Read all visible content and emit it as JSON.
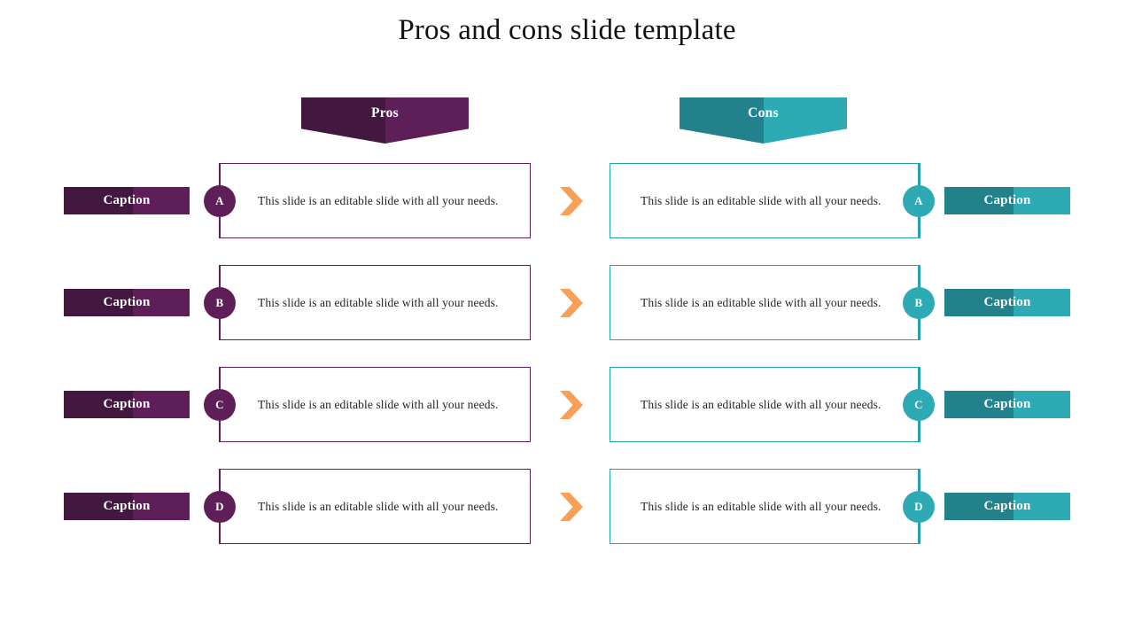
{
  "slide": {
    "title": "Pros and cons slide template",
    "background": "#ffffff"
  },
  "colors": {
    "pros_dark": "#431840",
    "pros_light": "#5e1f59",
    "pros_border": "#5e1f59",
    "cons_dark": "#22818b",
    "cons_light": "#2eaab5",
    "cons_border": "#2aa0aa",
    "arrow_orange": "#f89f58",
    "body_text": "#231f20",
    "title_text": "#121212"
  },
  "columns": {
    "pros": {
      "header_label": "Pros",
      "header_icon": "down-chevron-banner"
    },
    "cons": {
      "header_label": "Cons",
      "header_icon": "down-chevron-banner"
    }
  },
  "rows": [
    {
      "badge": "A",
      "left": {
        "caption": "Caption",
        "body": "This slide is an editable slide with all your needs."
      },
      "arrow_icon": "chevron-right-icon",
      "right": {
        "caption": "Caption",
        "body": "This slide is an editable slide with all your needs."
      }
    },
    {
      "badge": "B",
      "left": {
        "caption": "Caption",
        "body": "This slide is an editable slide with all your needs."
      },
      "arrow_icon": "chevron-right-icon",
      "right": {
        "caption": "Caption",
        "body": "This slide is an editable slide with all your needs."
      }
    },
    {
      "badge": "C",
      "left": {
        "caption": "Caption",
        "body": "This slide is an editable slide with all your needs."
      },
      "arrow_icon": "chevron-right-icon",
      "right": {
        "caption": "Caption",
        "body": "This slide is an editable slide with all your needs."
      }
    },
    {
      "badge": "D",
      "left": {
        "caption": "Caption",
        "body": "This slide is an editable slide with all your needs."
      },
      "arrow_icon": "chevron-right-icon",
      "right": {
        "caption": "Caption",
        "body": "This slide is an editable slide with all your needs."
      }
    }
  ]
}
